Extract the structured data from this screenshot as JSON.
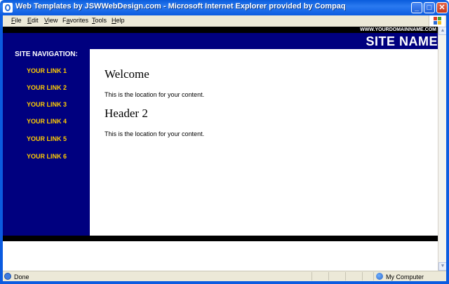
{
  "window": {
    "title": "Web Templates by JSWWebDesign.com - Microsoft Internet Explorer provided by Compaq",
    "controls": {
      "minimize": "_",
      "maximize": "□",
      "close": "✕"
    }
  },
  "menubar": {
    "items": [
      {
        "label": "File",
        "accel": "F",
        "rest": "ile"
      },
      {
        "label": "Edit",
        "accel": "E",
        "rest": "dit"
      },
      {
        "label": "View",
        "accel": "V",
        "rest": "iew"
      },
      {
        "label": "Favorites",
        "accel": "a",
        "pre": "F",
        "rest": "vorites"
      },
      {
        "label": "Tools",
        "accel": "T",
        "rest": "ools"
      },
      {
        "label": "Help",
        "accel": "H",
        "rest": "elp"
      }
    ]
  },
  "page": {
    "domain": "WWW.YOURDOMAINNAME.COM",
    "site_name": "SITE NAME",
    "nav_title": "SITE NAVIGATION:",
    "nav_links": [
      "YOUR LINK 1",
      "YOUR LINK 2",
      "YOUR LINK 3",
      "YOUR LINK 4",
      "YOUR LINK 5",
      "YOUR LINK 6"
    ],
    "heading1": "Welcome",
    "paragraph1": "This is the location for your content.",
    "heading2": "Header 2",
    "paragraph2": "This is the location for your content."
  },
  "statusbar": {
    "status": "Done",
    "zone": "My Computer"
  },
  "colors": {
    "header_bg": "#00007f",
    "link_color": "#ffcc00",
    "band_color": "#000000"
  }
}
